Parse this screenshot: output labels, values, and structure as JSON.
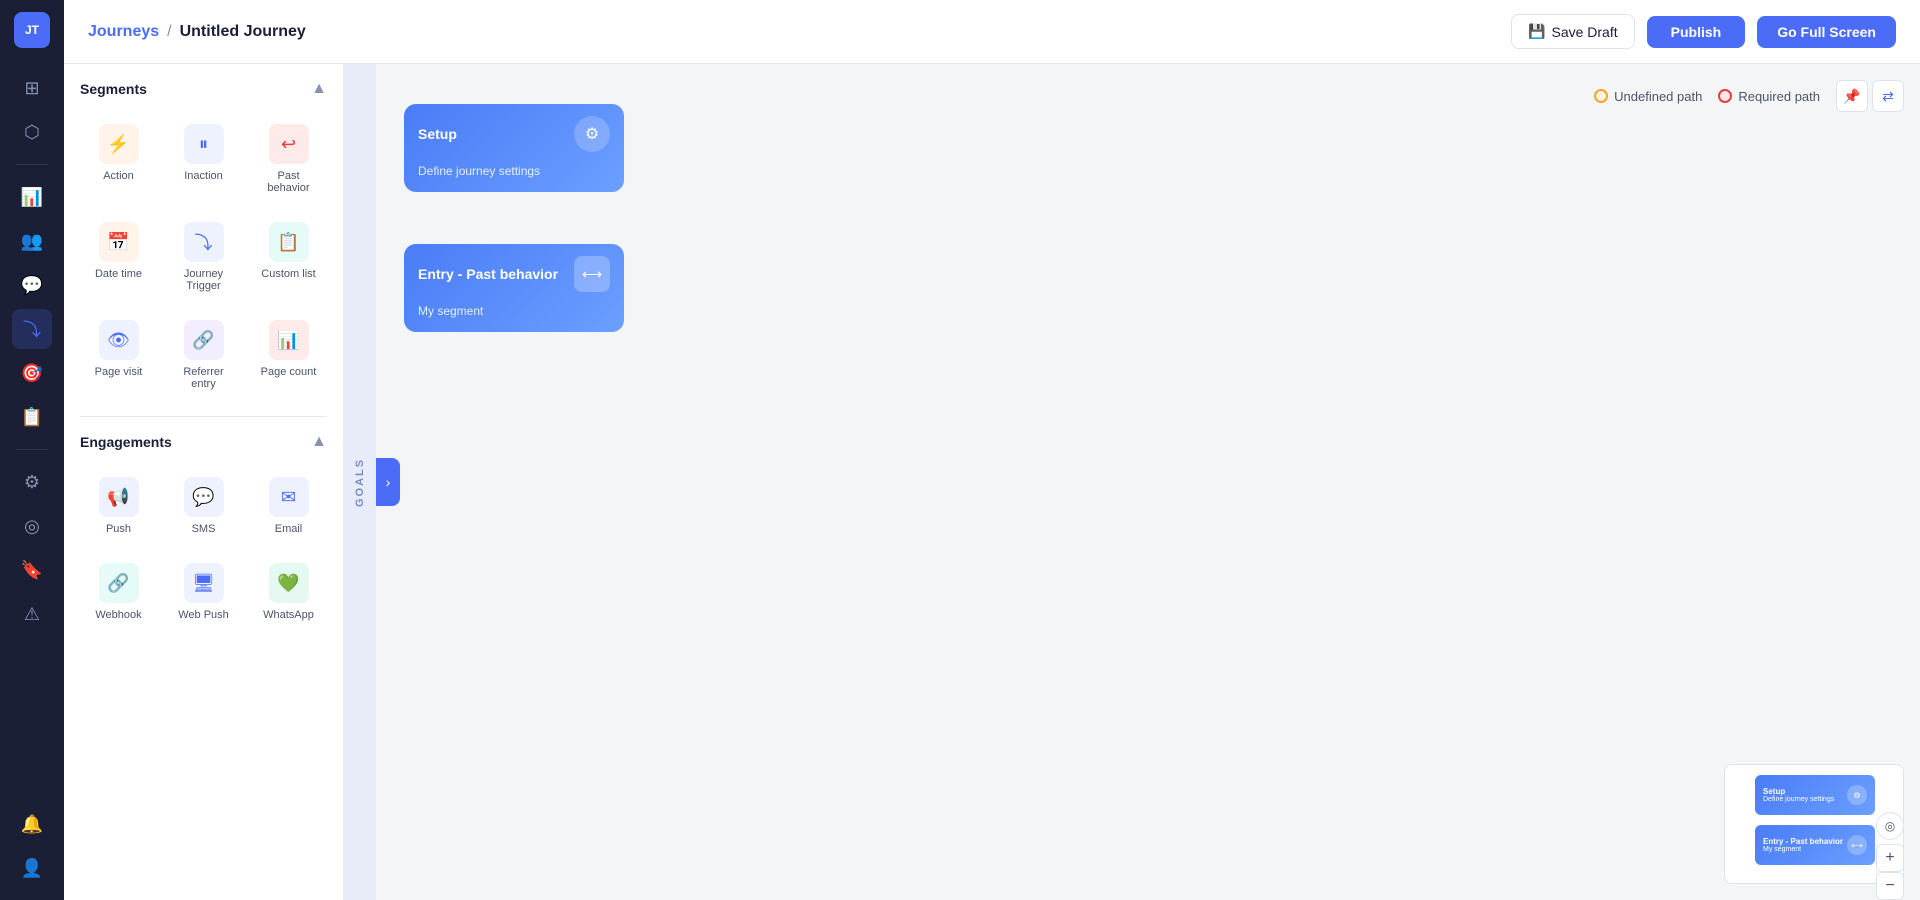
{
  "app": {
    "avatar": "JT",
    "title": "Journeys"
  },
  "header": {
    "breadcrumb_link": "Journeys",
    "breadcrumb_separator": "/",
    "breadcrumb_current": "Untitled Journey",
    "save_draft_label": "Save Draft",
    "publish_label": "Publish",
    "go_full_screen_label": "Go Full Screen"
  },
  "sidebar": {
    "segments_title": "Segments",
    "segments_items": [
      {
        "id": "action",
        "label": "Action",
        "icon": "⚡"
      },
      {
        "id": "inaction",
        "label": "Inaction",
        "icon": "⏸"
      },
      {
        "id": "past-behavior",
        "label": "Past behavior",
        "icon": "↩"
      },
      {
        "id": "date-time",
        "label": "Date time",
        "icon": "📅"
      },
      {
        "id": "journey-trigger",
        "label": "Journey Trigger",
        "icon": "⤵"
      },
      {
        "id": "custom-list",
        "label": "Custom list",
        "icon": "📋"
      },
      {
        "id": "page-visit",
        "label": "Page visit",
        "icon": "👁"
      },
      {
        "id": "referrer-entry",
        "label": "Referrer entry",
        "icon": "🔗"
      },
      {
        "id": "page-count",
        "label": "Page count",
        "icon": "📊"
      }
    ],
    "engagements_title": "Engagements",
    "engagements_items": [
      {
        "id": "push",
        "label": "Push",
        "icon": "📢"
      },
      {
        "id": "sms",
        "label": "SMS",
        "icon": "💬"
      },
      {
        "id": "email",
        "label": "Email",
        "icon": "✉"
      },
      {
        "id": "webhook",
        "label": "Webhook",
        "icon": "🔗"
      },
      {
        "id": "web-push",
        "label": "Web Push",
        "icon": "🖥"
      },
      {
        "id": "whatsapp",
        "label": "WhatsApp",
        "icon": "💚"
      }
    ]
  },
  "canvas": {
    "goals_label": "GOALS",
    "undefined_path_label": "Undefined path",
    "required_path_label": "Required path",
    "nodes": [
      {
        "id": "setup",
        "title": "Setup",
        "subtitle": "Define journey settings",
        "type": "setup"
      },
      {
        "id": "entry",
        "title": "Entry - Past behavior",
        "subtitle": "My segment",
        "type": "entry"
      }
    ],
    "mini_map": {
      "setup_title": "Setup",
      "setup_subtitle": "Define journey settings",
      "entry_title": "Entry - Past behavior",
      "entry_subtitle": "My segment"
    }
  },
  "nav_icons": [
    {
      "id": "dashboard",
      "icon": "⊞"
    },
    {
      "id": "connections",
      "icon": "⬡"
    },
    {
      "id": "analytics",
      "icon": "📊"
    },
    {
      "id": "users",
      "icon": "👥"
    },
    {
      "id": "messages",
      "icon": "💬"
    },
    {
      "id": "journeys",
      "icon": "⤵",
      "active": true
    },
    {
      "id": "campaigns",
      "icon": "🎯"
    },
    {
      "id": "reports",
      "icon": "📋"
    },
    {
      "id": "settings",
      "icon": "⚙"
    },
    {
      "id": "targeting",
      "icon": "🎯"
    },
    {
      "id": "bookmarks",
      "icon": "🔖"
    },
    {
      "id": "alerts",
      "icon": "⚠"
    }
  ],
  "nav_bottom": [
    {
      "id": "notifications",
      "icon": "🔔"
    },
    {
      "id": "users-bottom",
      "icon": "👤"
    }
  ]
}
